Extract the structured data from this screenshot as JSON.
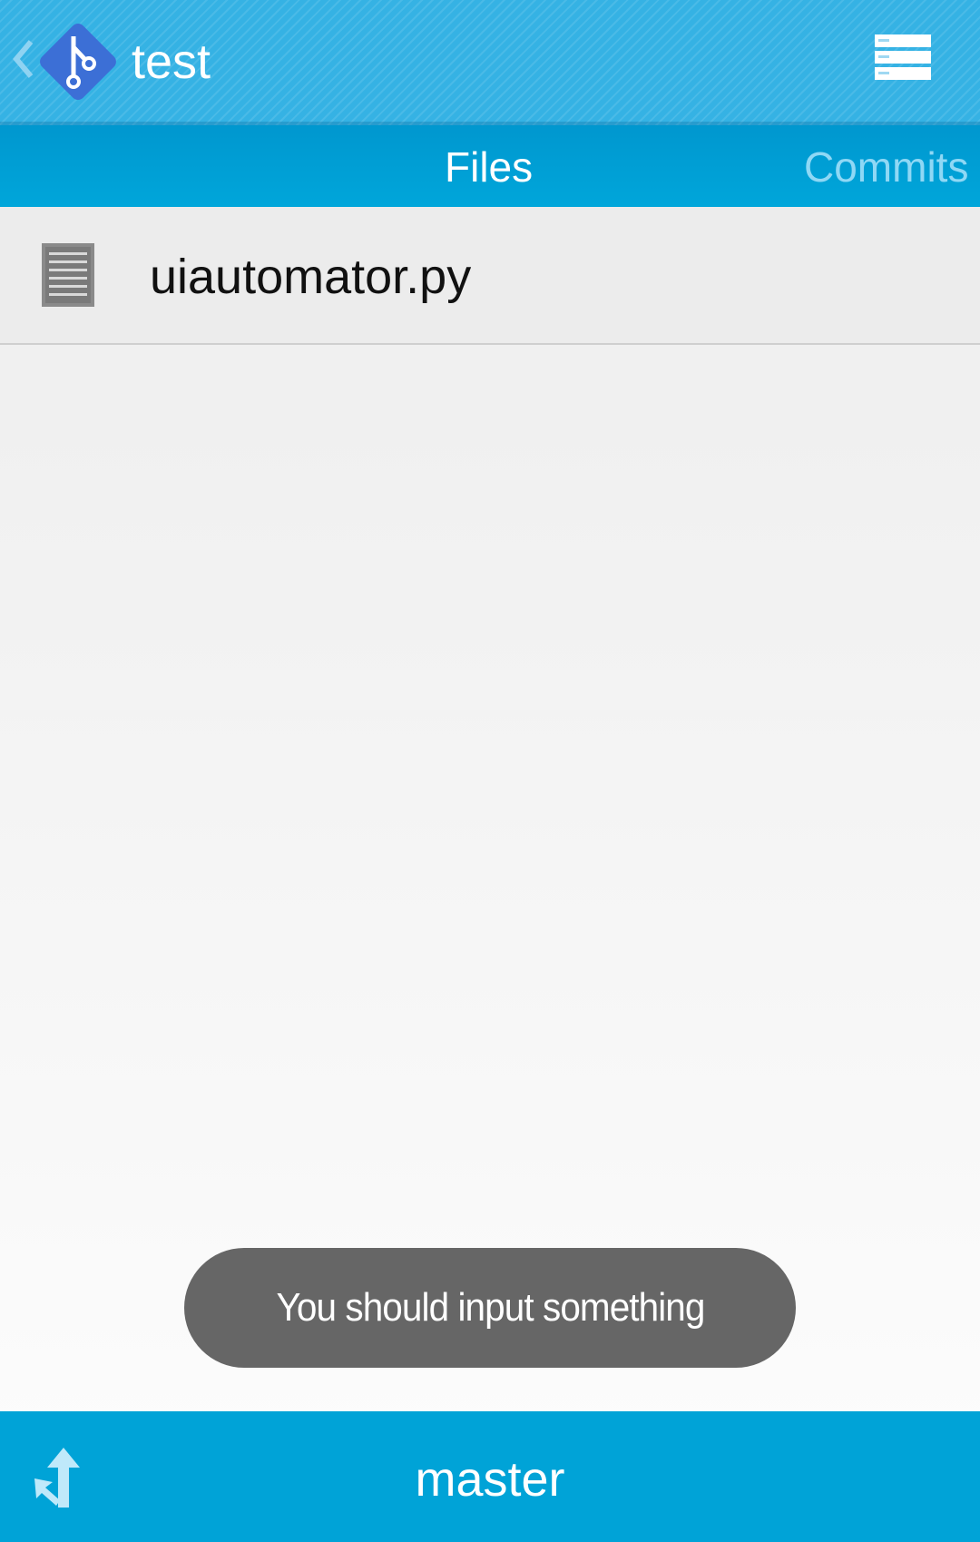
{
  "action_bar": {
    "title": "test",
    "up_icon": "chevron-left-icon",
    "logo_icon": "git-logo-icon",
    "overflow_icon": "list-menu-icon"
  },
  "tabs": [
    {
      "label": "Files",
      "selected": true
    },
    {
      "label": "Commits",
      "selected": false
    }
  ],
  "files": [
    {
      "name": "uiautomator.py",
      "icon": "document-icon"
    }
  ],
  "toast": {
    "message": "You should input something"
  },
  "branch_bar": {
    "branch": "master",
    "icon": "branch-icon"
  },
  "colors": {
    "action_bar": "#35b2e4",
    "tab_strip": "#00a6da",
    "tab_active_text": "#ffffff",
    "tab_inactive_text": "#8fd8f5",
    "bottom_bar": "#00a3d7",
    "logo": "#3c6fd6",
    "toast": "#666666"
  }
}
